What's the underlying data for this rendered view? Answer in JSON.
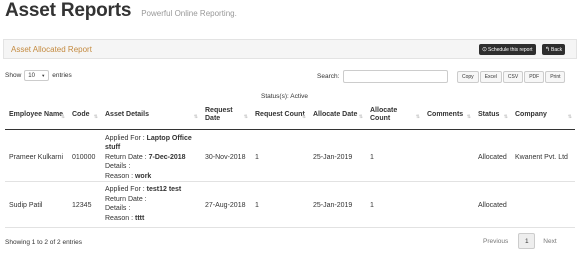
{
  "header": {
    "title": "Asset Reports",
    "subtitle": "Powerful Online Reporting."
  },
  "report_bar": {
    "title": "Asset Allocated Report",
    "schedule_label": "Schedule this report",
    "back_label": "Back"
  },
  "length": {
    "prefix": "Show",
    "value": "10",
    "suffix": "entries"
  },
  "search": {
    "label": "Search:",
    "value": ""
  },
  "export": [
    "Copy",
    "Excel",
    "CSV",
    "PDF",
    "Print"
  ],
  "status_filter": {
    "label": "Status(s):",
    "value": "Active"
  },
  "table": {
    "headers": [
      "Employee Name",
      "Code",
      "Asset Details",
      "Request Date",
      "Request Count",
      "Allocate Date",
      "Allocate Count",
      "Comments",
      "Status",
      "Company"
    ],
    "rows": [
      {
        "employee": "Prameer Kulkarni",
        "code": "010000",
        "applied_label": "Applied For :",
        "applied_value": "Laptop Office stuff",
        "return_label": "Return Date :",
        "return_value": "7-Dec-2018",
        "details_label": "Details :",
        "reason_label": "Reason :",
        "reason_value": "work",
        "request_date": "30-Nov-2018",
        "request_count": "1",
        "allocate_date": "25-Jan-2019",
        "allocate_count": "1",
        "comments": "",
        "status": "Allocated",
        "company": "Kwanent Pvt. Ltd"
      },
      {
        "employee": "Sudip Patil",
        "code": "12345",
        "applied_label": "Applied For :",
        "applied_value": "test12 test",
        "return_label": "Return Date :",
        "return_value": "",
        "details_label": "Details :",
        "reason_label": "Reason :",
        "reason_value": "tttt",
        "request_date": "27-Aug-2018",
        "request_count": "1",
        "allocate_date": "25-Jan-2019",
        "allocate_count": "1",
        "comments": "",
        "status": "Allocated",
        "company": ""
      }
    ]
  },
  "footer": {
    "info": "Showing 1 to 2 of 2 entries"
  },
  "pager": {
    "prev": "Previous",
    "current": "1",
    "next": "Next"
  }
}
